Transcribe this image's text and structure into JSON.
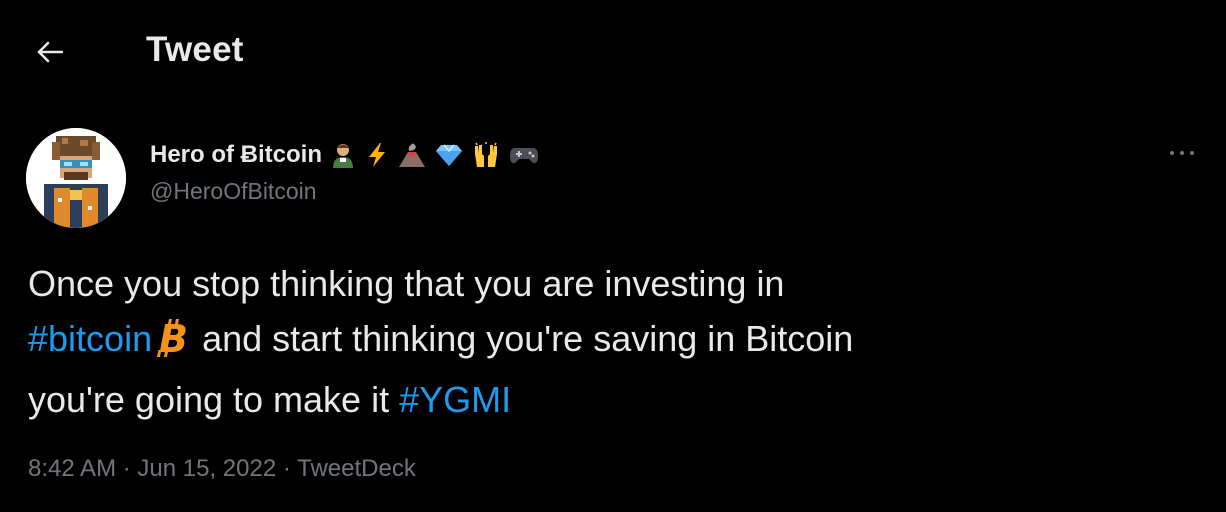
{
  "header": {
    "title": "Tweet",
    "back_icon": "arrow-left-icon"
  },
  "tweet": {
    "author_name": "Hero of Ƀitcoin",
    "name_emojis": [
      "person-icon",
      "lightning-icon",
      "volcano-icon",
      "diamond-icon",
      "raised-hands-icon",
      "game-controller-icon"
    ],
    "handle": "@HeroOfBitcoin",
    "more_icon": "more-dots-icon",
    "text": {
      "line1": "Once you stop thinking that you are investing in",
      "hashtag_bitcoin": "#bitcoin",
      "bitcoin_icon": "bitcoin-icon",
      "middle": "and start thinking you're saving in Bitcoin",
      "line3": "you're going to make it",
      "hashtag_ygmi": "#YGMI"
    },
    "time": "8:42 AM",
    "sep": "·",
    "date": "Jun 15, 2022",
    "source": "TweetDeck"
  },
  "colors": {
    "background": "#000000",
    "text": "#e7e9ea",
    "secondary": "#71767b",
    "link": "#1d9bf0",
    "bitcoin": "#f7931a"
  }
}
